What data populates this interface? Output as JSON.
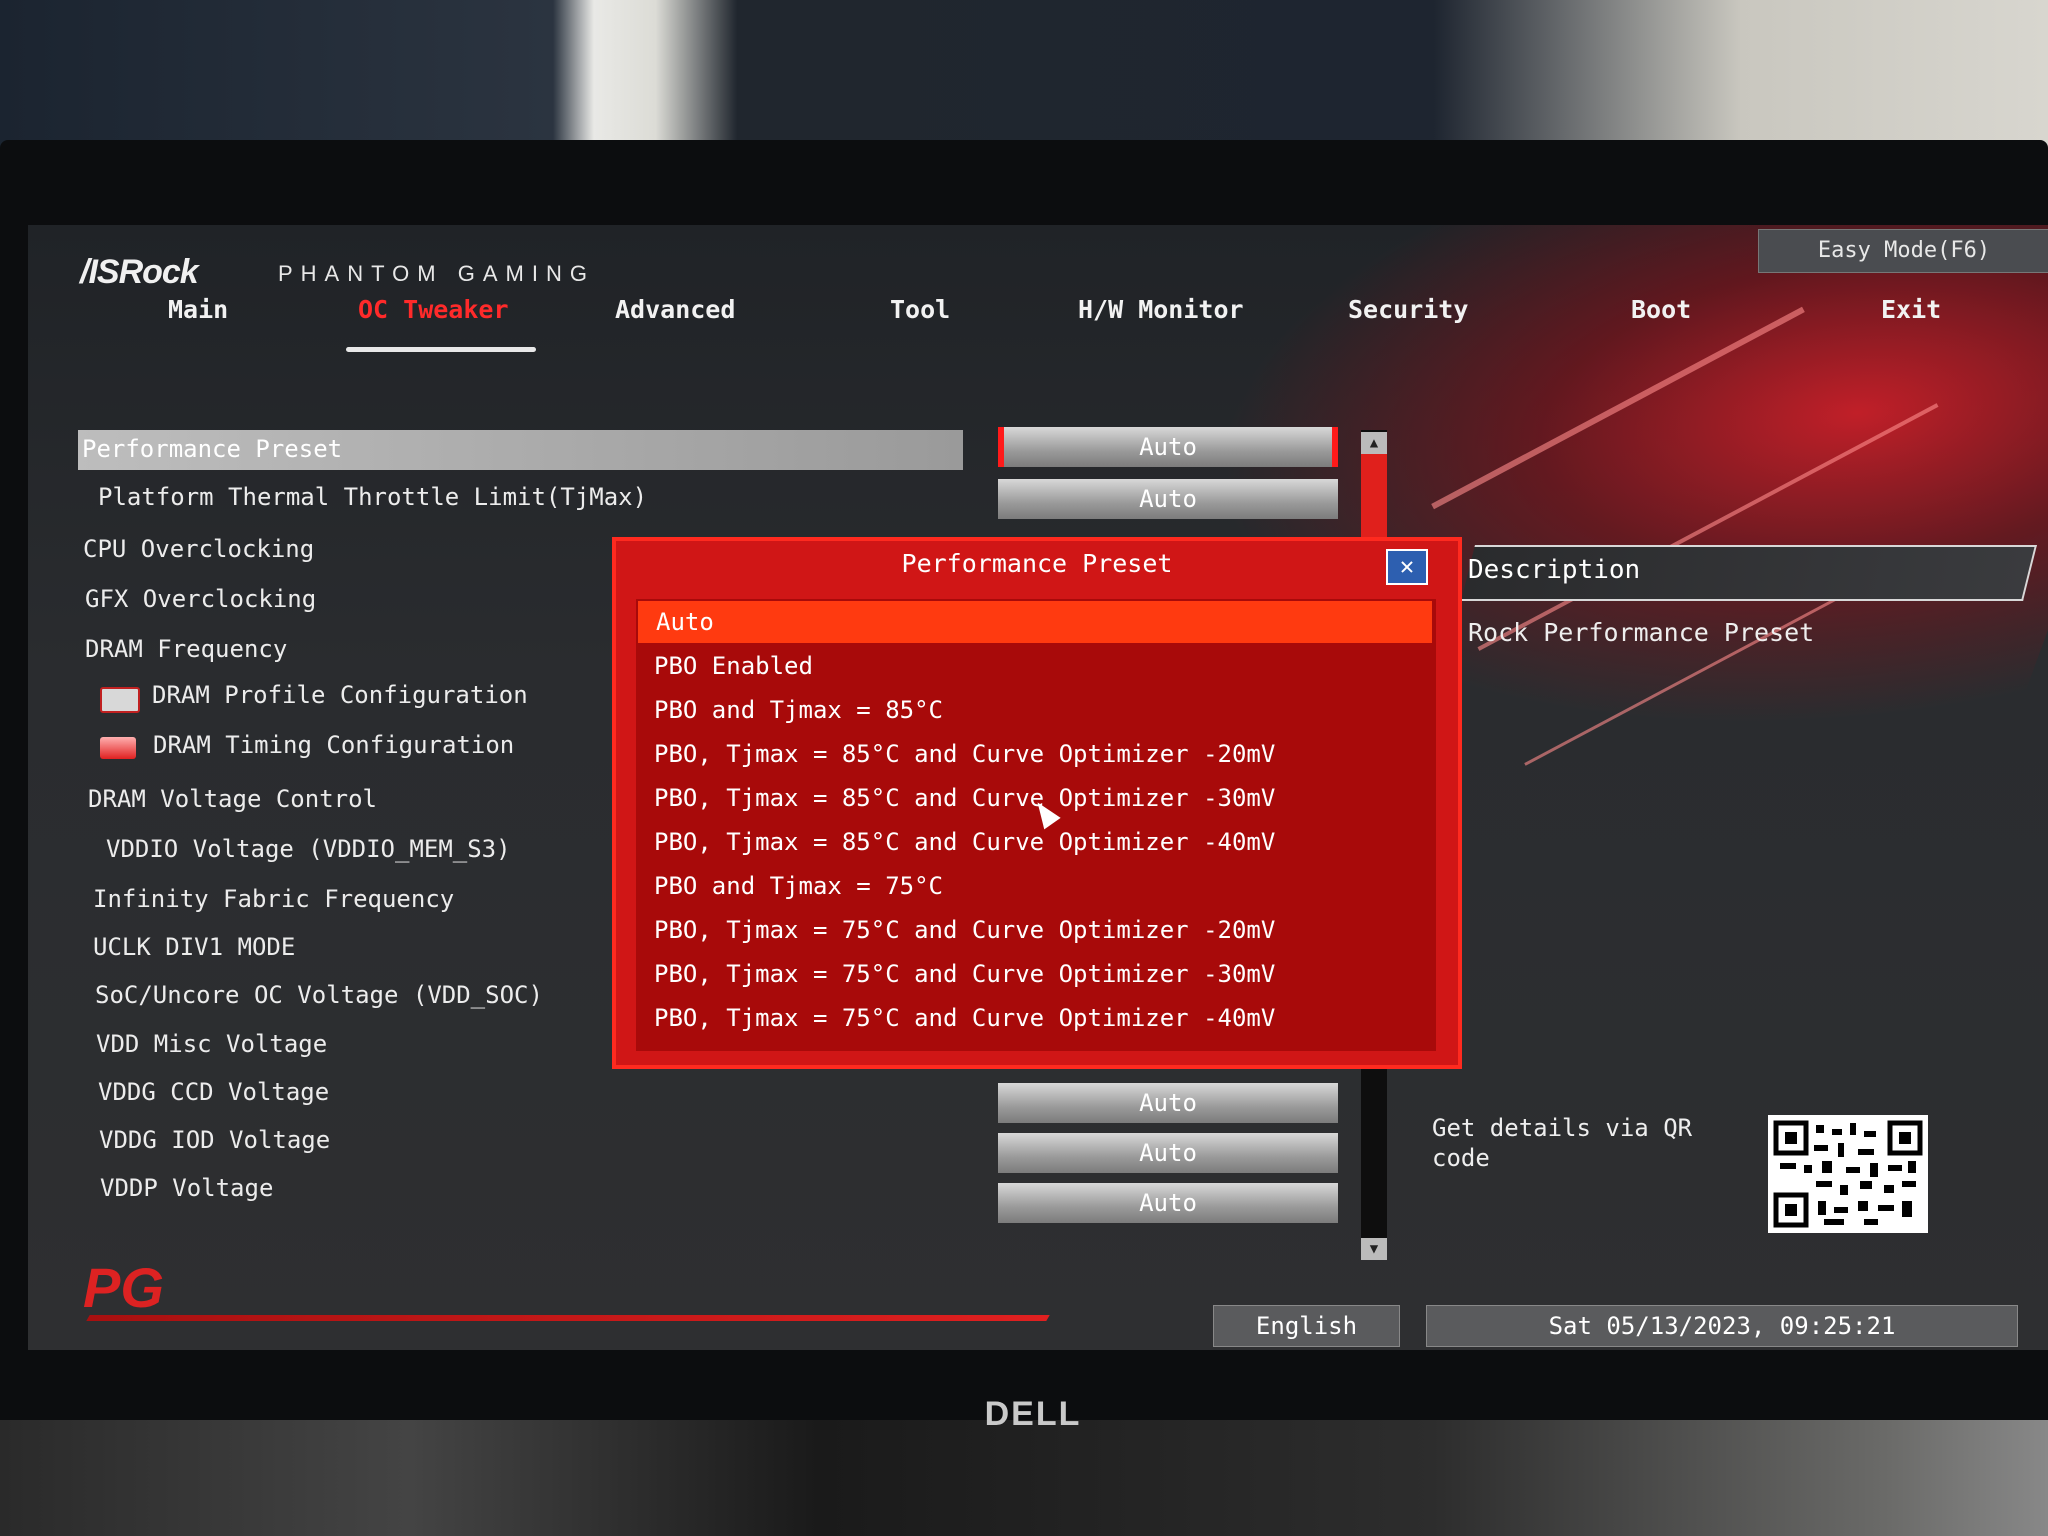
{
  "header": {
    "brand": "/ISRock",
    "subtitle": "PHANTOM GAMING",
    "easy_mode": "Easy Mode(F6)"
  },
  "tabs": [
    {
      "label": "Main"
    },
    {
      "label": "OC Tweaker"
    },
    {
      "label": "Advanced"
    },
    {
      "label": "Tool"
    },
    {
      "label": "H/W Monitor"
    },
    {
      "label": "Security"
    },
    {
      "label": "Boot"
    },
    {
      "label": "Exit"
    }
  ],
  "menu": {
    "selected": "Performance Preset",
    "items": [
      "Platform Thermal Throttle Limit(TjMax)",
      "CPU Overclocking",
      "GFX Overclocking",
      "DRAM Frequency",
      "DRAM Profile Configuration",
      "DRAM Timing Configuration",
      "DRAM Voltage Control",
      "VDDIO Voltage (VDDIO_MEM_S3)",
      "Infinity Fabric Frequency",
      "UCLK DIV1 MODE",
      "SoC/Uncore OC Voltage (VDD_SOC)",
      "VDD Misc Voltage",
      "VDDG CCD Voltage",
      "VDDG IOD Voltage",
      "VDDP Voltage"
    ]
  },
  "values": {
    "performance_preset": "Auto",
    "tjmax": "Auto",
    "vddg_ccd": "Auto",
    "vddg_iod": "Auto",
    "vddp": "Auto"
  },
  "description": {
    "title": "Description",
    "text": "Rock Performance Preset",
    "qr_text": "Get details via QR code"
  },
  "popup": {
    "title": "Performance Preset",
    "close_icon": "close-icon",
    "options": [
      "Auto",
      "PBO Enabled",
      "PBO and Tjmax = 85°C",
      "PBO, Tjmax = 85°C and Curve Optimizer -20mV",
      "PBO, Tjmax = 85°C and Curve Optimizer -30mV",
      "PBO, Tjmax = 85°C and Curve Optimizer -40mV",
      "PBO and Tjmax = 75°C",
      "PBO, Tjmax = 75°C and Curve Optimizer -20mV",
      "PBO, Tjmax = 75°C and Curve Optimizer -30mV",
      "PBO, Tjmax = 75°C and Curve Optimizer -40mV"
    ],
    "selected_index": 0
  },
  "footer": {
    "language": "English",
    "datetime": "Sat 05/13/2023, 09:25:21"
  },
  "monitor_brand": "DELL",
  "colors": {
    "accent": "#ff2a2a",
    "popup_bg": "#d01616",
    "popup_selected": "#ff3a10"
  }
}
